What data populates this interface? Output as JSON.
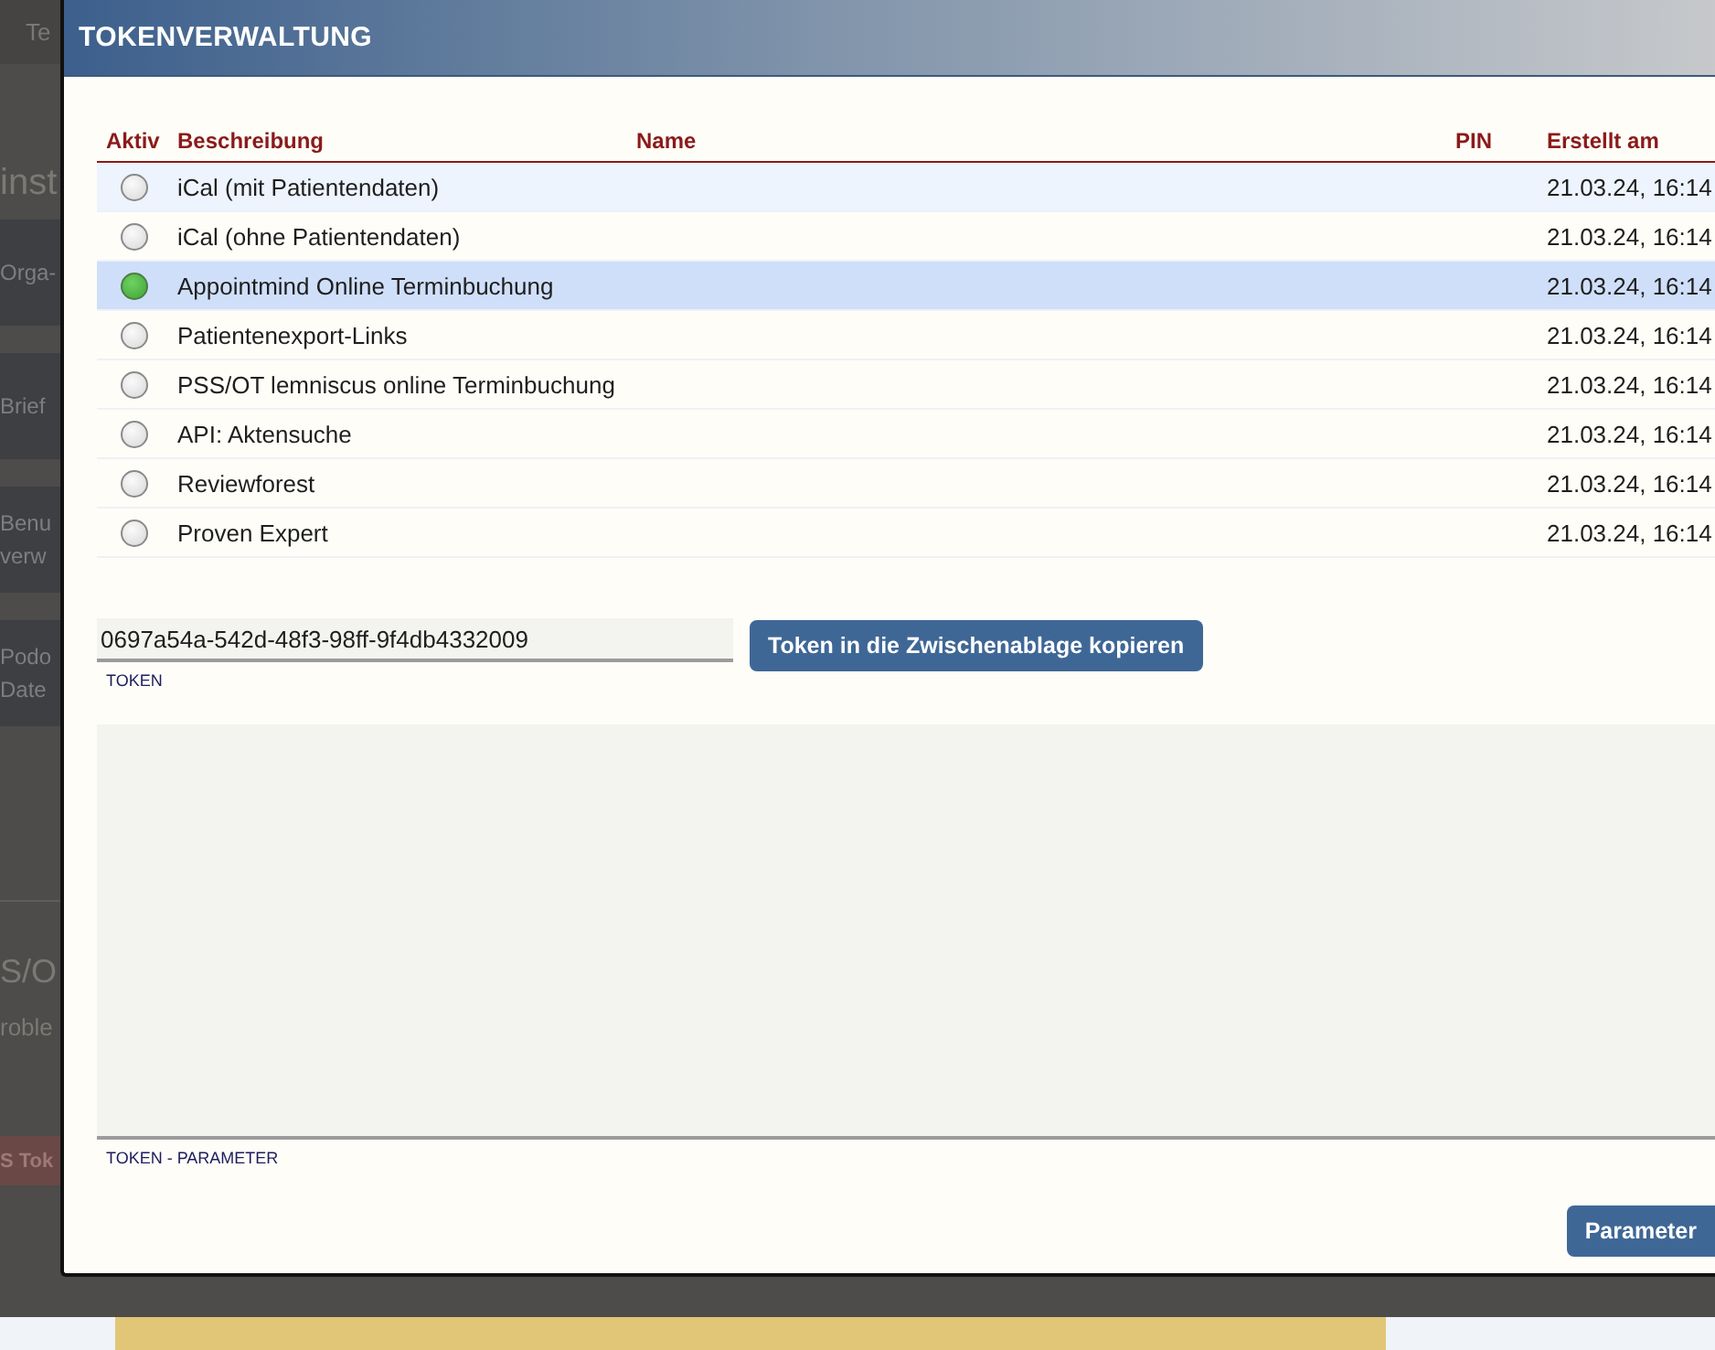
{
  "background": {
    "tab": "Te",
    "heading": "inst",
    "menu_items": [
      {
        "lines": [
          "Orga-"
        ]
      },
      {
        "lines": [
          "Brief"
        ]
      },
      {
        "lines": [
          "Benu",
          "verw"
        ]
      },
      {
        "lines": [
          "Podo",
          "Date"
        ]
      }
    ],
    "section_title": "S/O",
    "section_text": "roble",
    "button": "S Tok"
  },
  "dialog": {
    "title": "TOKENVERWALTUNG",
    "table": {
      "columns": [
        "Aktiv",
        "Beschreibung",
        "Name",
        "PIN",
        "Erstellt am"
      ],
      "rows": [
        {
          "active": false,
          "selected": false,
          "hovered": true,
          "description": "iCal (mit Patientendaten)",
          "created": "21.03.24, 16:14"
        },
        {
          "active": false,
          "selected": false,
          "hovered": false,
          "description": "iCal (ohne Patientendaten)",
          "created": "21.03.24, 16:14"
        },
        {
          "active": true,
          "selected": true,
          "hovered": false,
          "description": "Appointmind Online Terminbuchung",
          "created": "21.03.24, 16:14"
        },
        {
          "active": false,
          "selected": false,
          "hovered": false,
          "description": "Patientenexport-Links",
          "created": "21.03.24, 16:14"
        },
        {
          "active": false,
          "selected": false,
          "hovered": false,
          "description": "PSS/OT lemniscus online Terminbuchung",
          "created": "21.03.24, 16:14"
        },
        {
          "active": false,
          "selected": false,
          "hovered": false,
          "description": "API: Aktensuche",
          "created": "21.03.24, 16:14"
        },
        {
          "active": false,
          "selected": false,
          "hovered": false,
          "description": "Reviewforest",
          "created": "21.03.24, 16:14"
        },
        {
          "active": false,
          "selected": false,
          "hovered": false,
          "description": "Proven Expert",
          "created": "21.03.24, 16:14"
        }
      ]
    },
    "token_field": {
      "value": "0697a54a-542d-48f3-98ff-9f4db4332009",
      "label": "TOKEN"
    },
    "copy_button": "Token in die Zwischenablage kopieren",
    "parameter_field": {
      "label": "TOKEN - PARAMETER"
    },
    "parameter_button": "Parameter"
  }
}
